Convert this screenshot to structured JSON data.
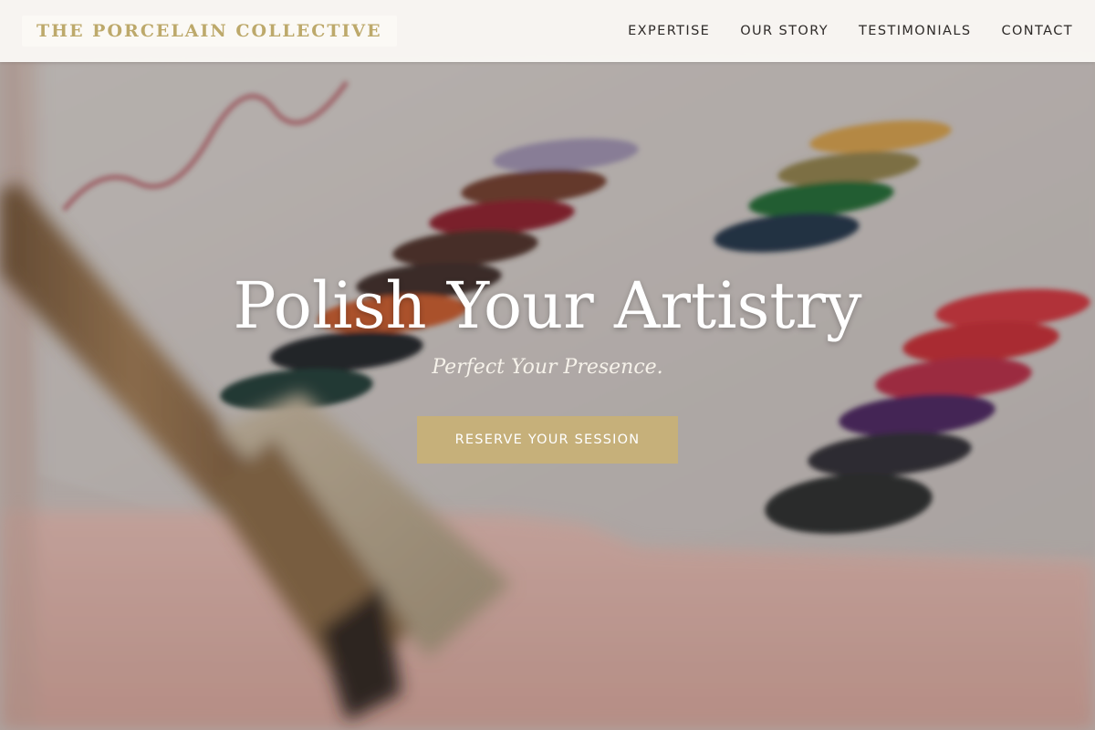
{
  "brand": {
    "name": "THE PORCELAIN COLLECTIVE"
  },
  "nav": {
    "links": [
      {
        "label": "EXPERTISE"
      },
      {
        "label": "OUR STORY"
      },
      {
        "label": "TESTIMONIALS"
      },
      {
        "label": "CONTACT"
      }
    ]
  },
  "hero": {
    "title": "Polish Your Artistry",
    "subtitle": "Perfect Your Presence.",
    "cta_label": "RESERVE YOUR SESSION",
    "background_image": "nail-polish-swatch-chart-with-brush"
  },
  "colors": {
    "accent": "#c6b07a",
    "brand_text": "#bda96b",
    "nav_text": "#2e2a28"
  }
}
